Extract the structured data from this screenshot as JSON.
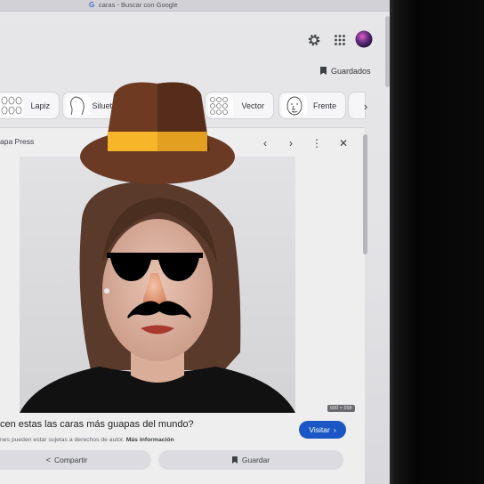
{
  "browser": {
    "tab_title": "caras - Buscar con Google",
    "tab_favicon": "G"
  },
  "header": {
    "icons": [
      "gear-icon",
      "apps-grid-icon",
      "avatar"
    ],
    "saved_label": "Guardados"
  },
  "chips": [
    {
      "label": "Lapiz",
      "thumb": "pencil-faces-thumbnail"
    },
    {
      "label": "Silueta",
      "thumb": "silhouette-thumbnail"
    },
    {
      "label": "Vector",
      "thumb": "vector-faces-thumbnail"
    },
    {
      "label": "Frente",
      "thumb": "front-face-thumbnail"
    }
  ],
  "panel": {
    "source": "apa Press",
    "image_dims": "600 × 558",
    "caption": "cen estas las caras más guapas del mundo?",
    "rights_text": "nes pueden estar sujetas a derechos de autor.",
    "more_info": "Más información",
    "visit_label": "Visitar",
    "share_label": "Compartir",
    "save_label": "Guardar"
  },
  "colors": {
    "accent": "#1a57c4",
    "hat_brown": "#6e3a22",
    "hat_band": "#f7b52a",
    "page_bg": "#e5e5e8",
    "screen_bezel": "#0a0a0a"
  }
}
